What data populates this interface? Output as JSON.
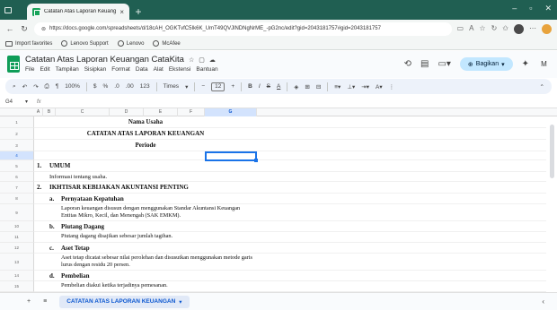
{
  "browser": {
    "tab_title": "Catatan Atas Laporan Keuangan",
    "tab_close": "×",
    "new_tab": "+",
    "win_min": "–",
    "win_max": "▫",
    "win_close": "✕",
    "url": "https://docs.google.com/spreadsheets/d/18cAH_OGKTvfC5Ik6K_UmT49QVJlNDNgNrME_-pG2nc/edit?gid=2043181757#gid=2043181757"
  },
  "bookmarks": [
    {
      "label": "Import favorites"
    },
    {
      "label": "Lenovo Support"
    },
    {
      "label": "Lenovo"
    },
    {
      "label": "McAfee"
    }
  ],
  "doc": {
    "title": "Catatan Atas Laporan Keuangan CataKita",
    "menu": [
      "File",
      "Edit",
      "Tampilan",
      "Sisipkan",
      "Format",
      "Data",
      "Alat",
      "Ekstensi",
      "Bantuan"
    ],
    "share_label": "Bagikan",
    "avatar_letter": "M"
  },
  "toolbar": {
    "zoom": "100%",
    "currency": "$",
    "percent": "%",
    "dec_dec": ".0",
    "dec_inc": ".00",
    "format_123": "123",
    "font": "Times",
    "font_size": "12",
    "bold": "B",
    "italic": "I",
    "strike": "S",
    "text_color": "A"
  },
  "formula": {
    "cell_ref": "G4",
    "fx": "fx"
  },
  "columns": [
    "A",
    "B",
    "C",
    "D",
    "E",
    "F",
    "G"
  ],
  "rows": [
    {
      "num": "1",
      "text": "Nama Usaha",
      "style": "center-bold"
    },
    {
      "num": "2",
      "text": "CATATAN ATAS LAPORAN KEUANGAN",
      "style": "center-bold"
    },
    {
      "num": "3",
      "text": "Periode",
      "style": "center-bold"
    },
    {
      "num": "4",
      "text": "",
      "style": "empty"
    },
    {
      "num": "5",
      "label": "1.",
      "text": "UMUM",
      "style": "h1"
    },
    {
      "num": "6",
      "text": "Informasi tentang usaha.",
      "style": "p1"
    },
    {
      "num": "7",
      "label": "2.",
      "text": "IKHTISAR KEBIJAKAN AKUNTANSI PENTING",
      "style": "h1"
    },
    {
      "num": "8",
      "label": "a.",
      "text": "Pernyataan Kepatuhan",
      "style": "h2"
    },
    {
      "num": "9",
      "text": "Laporan keuangan disusun dengan menggunakan Standar Akuntansi Keuangan Entitas Mikro, Kecil, dan Menengah (SAK EMKM).",
      "style": "p2"
    },
    {
      "num": "10",
      "label": "b.",
      "text": "Piutang Dagang",
      "style": "h2"
    },
    {
      "num": "11",
      "text": "Piutang dagang disajikan sebesar jumlah tagihan.",
      "style": "p2"
    },
    {
      "num": "12",
      "label": "c.",
      "text": "Aset Tetap",
      "style": "h2"
    },
    {
      "num": "13",
      "text": "Aset tetap dicatat sebesar nilai perolehan dan disusutkan menggunakan metode garis lurus dengan residu 20 persen.",
      "style": "p2"
    },
    {
      "num": "14",
      "label": "d.",
      "text": "Pembelian",
      "style": "h2"
    },
    {
      "num": "15",
      "text": "Pembelian diakui ketika terjadinya pemesanan.",
      "style": "p2"
    }
  ],
  "sheet_tab": "CATATAN ATAS LAPORAN KEUANGAN",
  "colors": {
    "browser_chrome": "#205f52",
    "sheets_green": "#0f9d58",
    "share_bg": "#c2e7ff",
    "selection": "#1a73e8"
  }
}
